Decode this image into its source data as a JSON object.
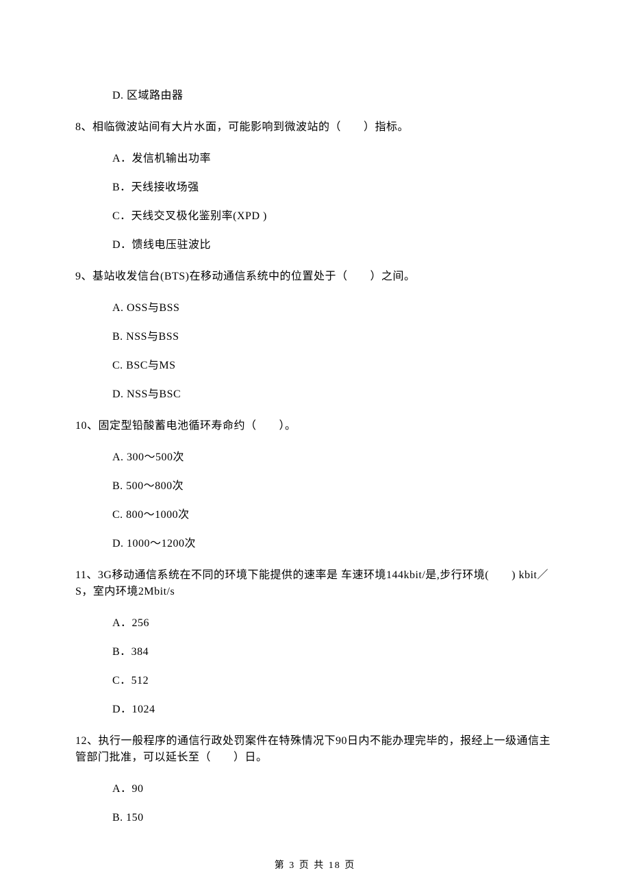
{
  "q7": {
    "options": {
      "D": "D.  区域路由器"
    }
  },
  "q8": {
    "text": "8、相临微波站间有大片水面，可能影响到微波站的（　　）指标。",
    "options": {
      "A": "A．发信机输出功率",
      "B": "B．天线接收场强",
      "C": "C．天线交叉极化鉴别率(XPD )",
      "D": "D．馈线电压驻波比"
    }
  },
  "q9": {
    "text": "9、基站收发信台(BTS)在移动通信系统中的位置处于（　　）之间。",
    "options": {
      "A": "A.  OSS与BSS",
      "B": "B.  NSS与BSS",
      "C": "C.  BSC与MS",
      "D": "D.  NSS与BSC"
    }
  },
  "q10": {
    "text": "10、固定型铅酸蓄电池循环寿命约（　　）。",
    "options": {
      "A": "A.  300～500次",
      "B": "B.  500～800次",
      "C": "C.  800～1000次",
      "D": "D.  1000～1200次"
    }
  },
  "q11": {
    "text": "11、3G移动通信系统在不同的环境下能提供的速率是 车速环境144kbit/是,步行环境(　　) kbit／S，室内环境2Mbit/s",
    "options": {
      "A": "A．256",
      "B": "B．384",
      "C": "C．512",
      "D": "D．1024"
    }
  },
  "q12": {
    "text": "12、执行一般程序的通信行政处罚案件在特殊情况下90日内不能办理完毕的，报经上一级通信主管部门批准，可以延长至（　　）日。",
    "options": {
      "A": "A．90",
      "B": "B.  150"
    }
  },
  "footer": "第 3 页 共 18 页"
}
